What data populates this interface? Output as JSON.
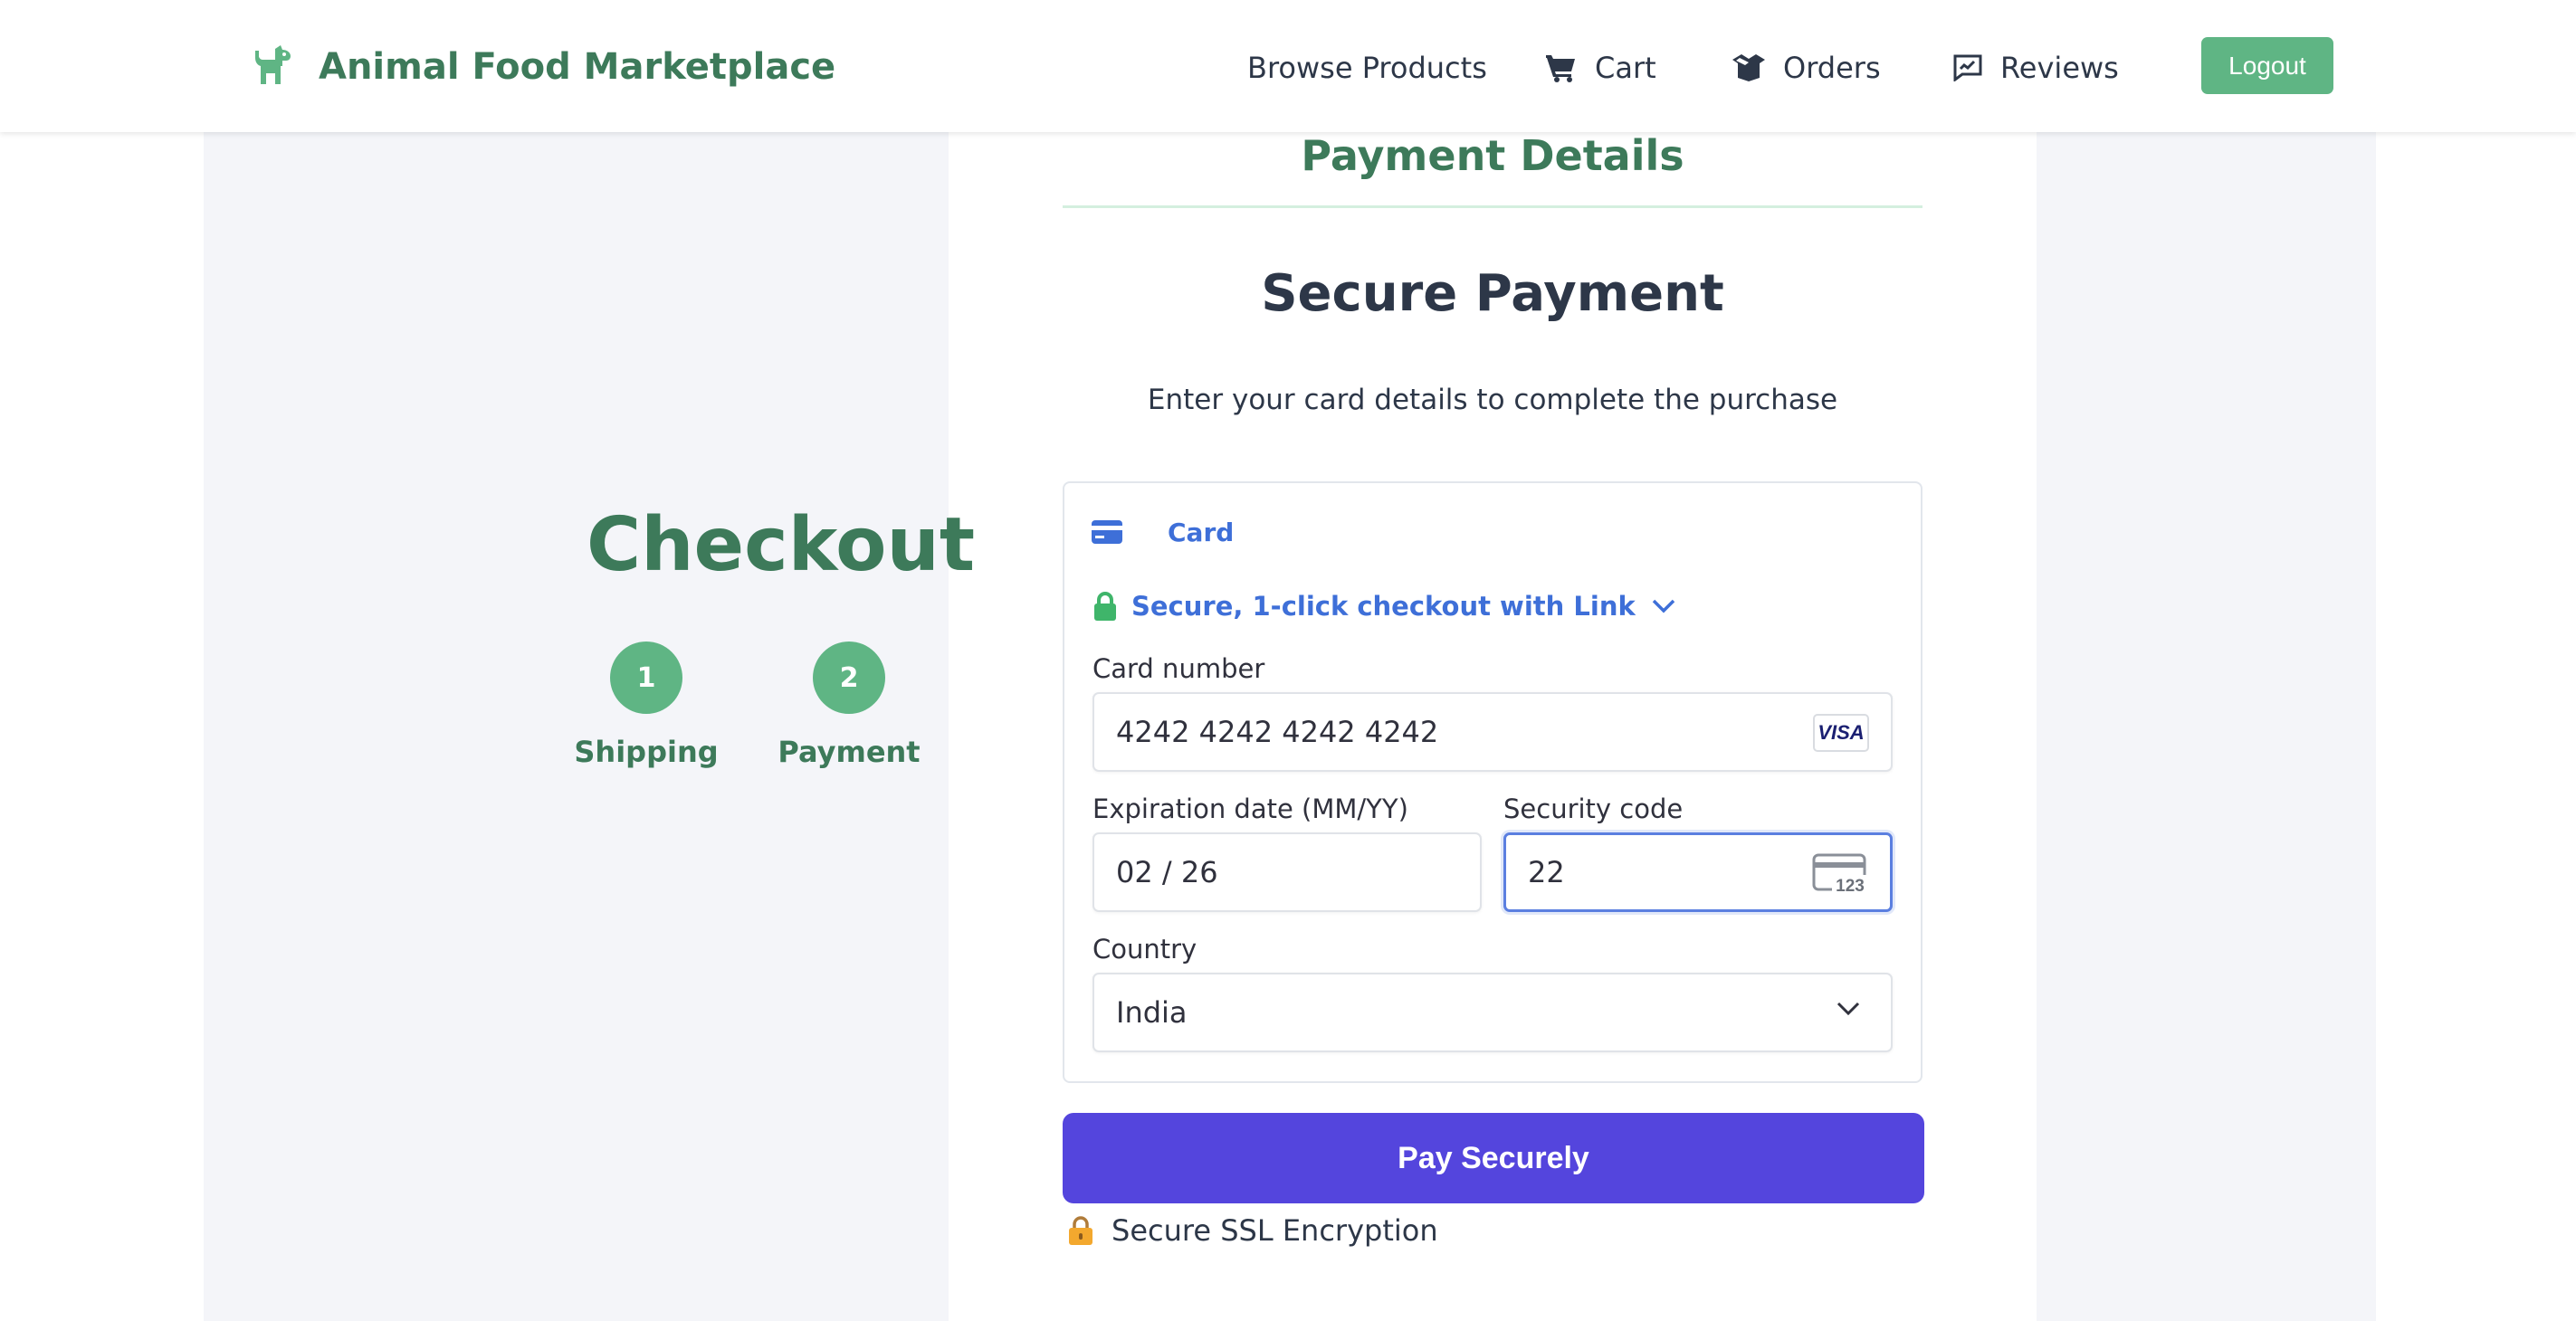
{
  "header": {
    "brand": "Animal Food Marketplace",
    "nav": {
      "browse": "Browse Products",
      "cart": "Cart",
      "orders": "Orders",
      "reviews": "Reviews"
    },
    "logout": "Logout",
    "brand_color": "#3d7a5a",
    "accent_color": "#5fb584"
  },
  "checkout": {
    "title": "Checkout",
    "steps": [
      {
        "number": "1",
        "label": "Shipping"
      },
      {
        "number": "2",
        "label": "Payment"
      }
    ]
  },
  "payment": {
    "section_title": "Payment Details",
    "heading": "Secure Payment",
    "subtitle": "Enter your card details to complete the purchase",
    "tab_label": "Card",
    "link_text": "Secure, 1-click checkout with Link",
    "card_number": {
      "label": "Card number",
      "value": "4242 4242 4242 4242",
      "brand": "VISA"
    },
    "expiry": {
      "label": "Expiration date (MM/YY)",
      "value": "02 / 26"
    },
    "cvc": {
      "label": "Security code",
      "value": "22",
      "icon_text": "123"
    },
    "country": {
      "label": "Country",
      "value": "India"
    },
    "pay_button": "Pay Securely",
    "ssl_text": "Secure SSL Encryption",
    "button_color": "#5445dd",
    "link_color": "#3e6fd8"
  }
}
